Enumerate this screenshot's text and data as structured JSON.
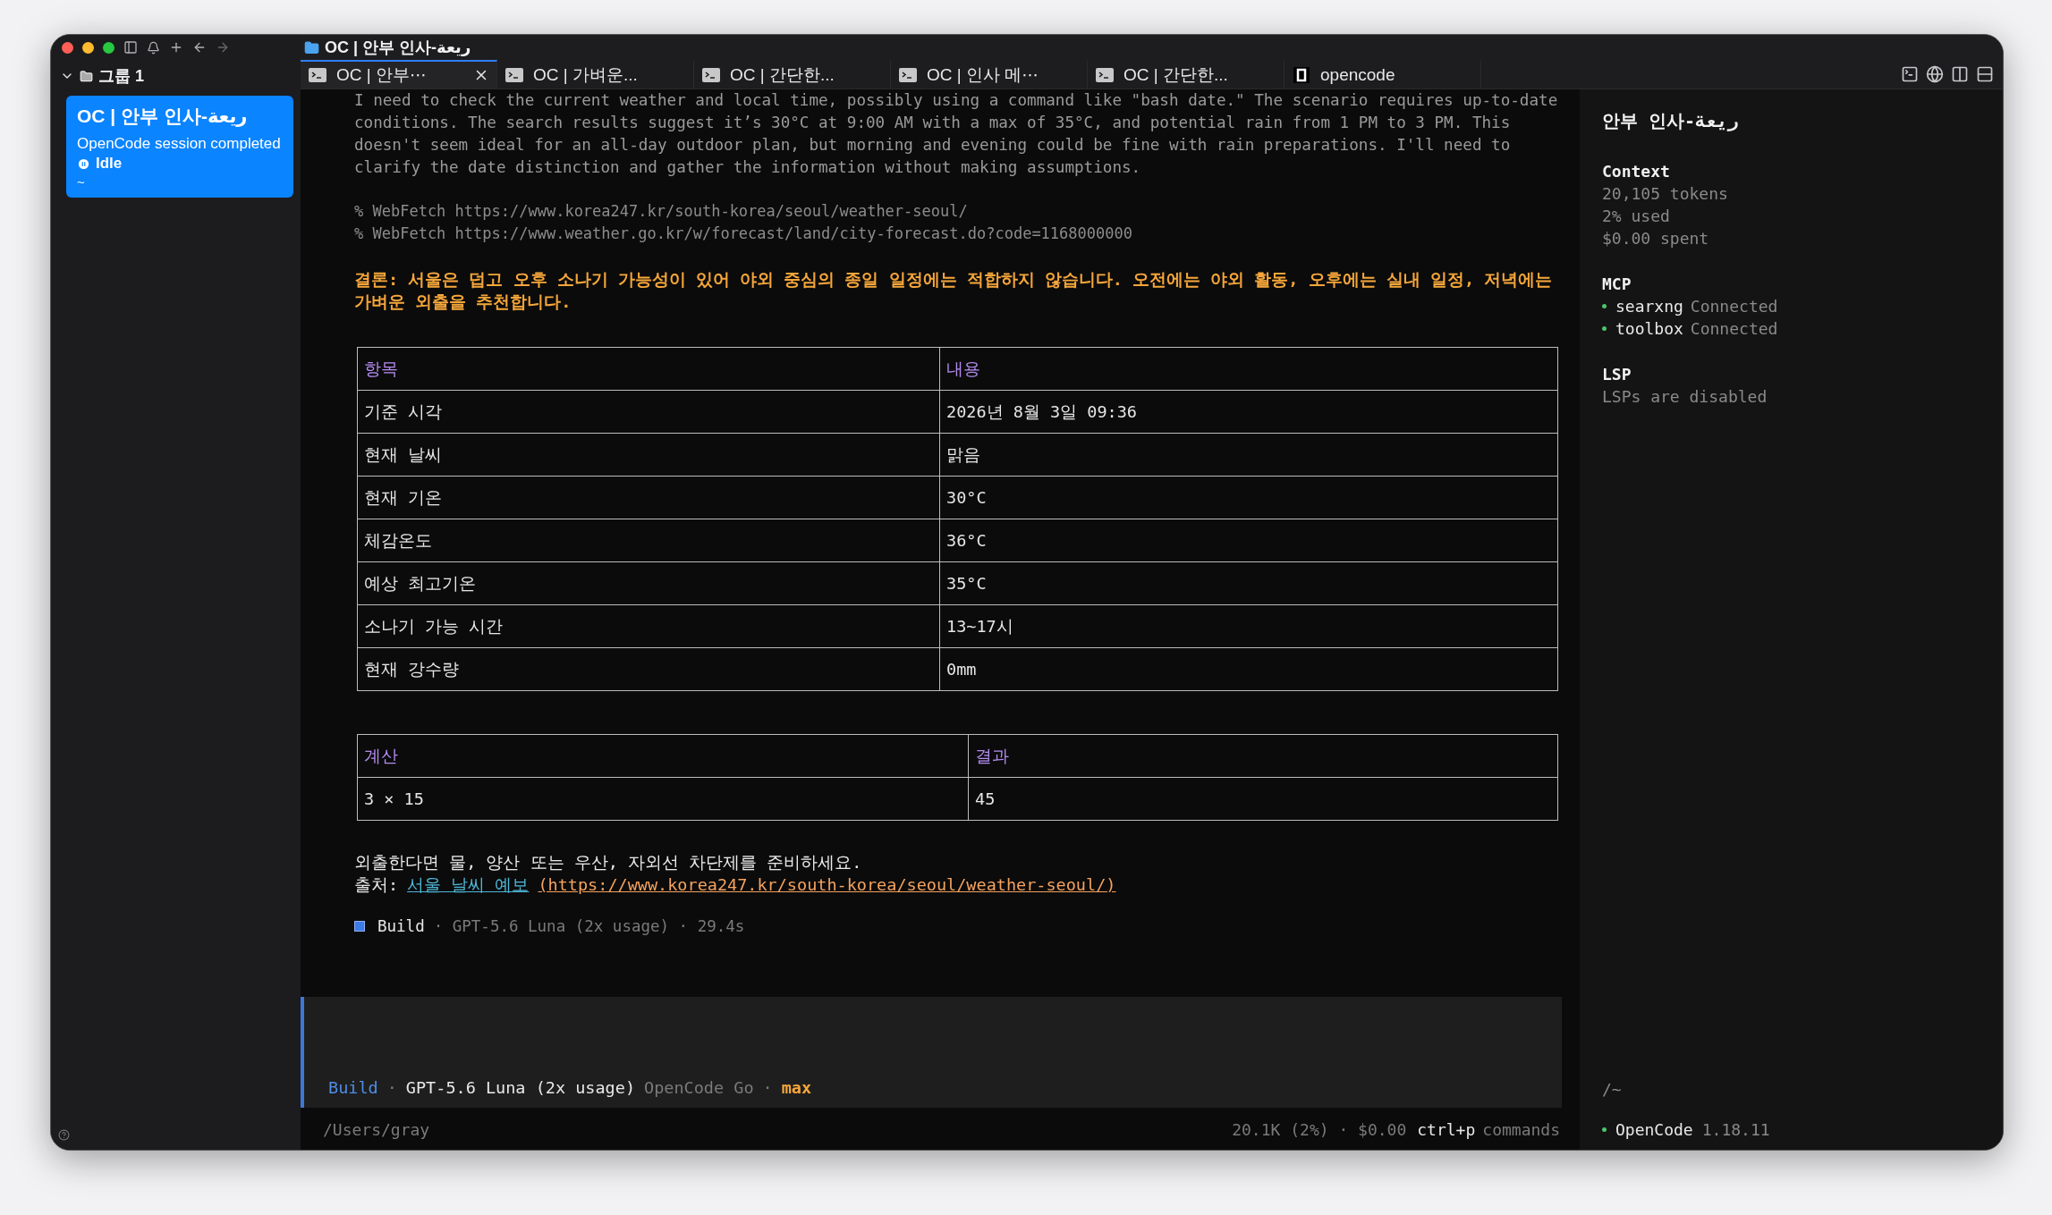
{
  "window": {
    "title": "OC | 안부 인사-ريعة"
  },
  "sidebar": {
    "group": {
      "label": "그룹 1",
      "expanded": true
    },
    "sessions": [
      {
        "title": "OC | 안부 인사-ريعة",
        "subtitle": "OpenCode session completed",
        "status": "Idle",
        "path": "~",
        "selected": true
      }
    ]
  },
  "tabs": [
    {
      "label": "OC | 안부⋯",
      "kind": "terminal",
      "selected": true
    },
    {
      "label": "OC | 가벼운...",
      "kind": "terminal",
      "selected": false
    },
    {
      "label": "OC | 간단한...",
      "kind": "terminal",
      "selected": false
    },
    {
      "label": "OC | 인사 메⋯",
      "kind": "terminal",
      "selected": false
    },
    {
      "label": "OC | 간단한...",
      "kind": "terminal",
      "selected": false
    },
    {
      "label": "opencode",
      "kind": "app",
      "selected": false
    }
  ],
  "transcript": {
    "reasoning": "I need to check the current weather and local time, possibly using a command like \"bash date.\" The scenario requires up-to-date conditions. The search results suggest it’s 30°C at 9:00 AM with a max of 35°C, and potential rain from 1 PM to 3 PM. This doesn't seem ideal for an all-day outdoor plan, but morning and evening could be fine with rain preparations. I'll need to clarify the date distinction and gather the information without making assumptions.",
    "tool_calls": [
      "% WebFetch https://www.korea247.kr/south-korea/seoul/weather-seoul/",
      "% WebFetch https://www.weather.go.kr/w/forecast/land/city-forecast.do?code=1168000000"
    ],
    "conclusion": "결론: 서울은 덥고 오후 소나기 가능성이 있어 야외 중심의 종일 일정에는 적합하지 않습니다. 오전에는 야외 활동, 오후에는 실내 일정, 저녁에는 가벼운 외출을 추천합니다.",
    "tables": [
      {
        "columns": [
          "항목",
          "내용"
        ],
        "rows": [
          [
            "기준 시각",
            "2026년 8월 3일 09:36"
          ],
          [
            "현재 날씨",
            "맑음"
          ],
          [
            "현재 기온",
            "30°C"
          ],
          [
            "체감온도",
            "36°C"
          ],
          [
            "예상 최고기온",
            "35°C"
          ],
          [
            "소나기 가능 시간",
            "13~17시"
          ],
          [
            "현재 강수량",
            "0mm"
          ]
        ]
      },
      {
        "columns": [
          "계산",
          "결과"
        ],
        "rows": [
          [
            "3 × 15",
            "45"
          ]
        ]
      }
    ],
    "note": "외출한다면 물, 양산 또는 우산, 자외선 차단제를 준비하세요.",
    "source": {
      "label": "출처:",
      "link": "서울 날씨 예보",
      "url": "(https://www.korea247.kr/south-korea/seoul/weather-seoul/)"
    },
    "run": {
      "agent": "Build",
      "details": "· GPT-5.6 Luna (2x usage) · 29.4s"
    }
  },
  "prompt": {
    "agent": "Build",
    "separator": "·",
    "model": "GPT-5.6 Luna (2x usage)",
    "provider": "OpenCode Go",
    "variant": "max"
  },
  "status_bar": {
    "path": "/Users/gray",
    "usage": "20.1K (2%) · $0.00",
    "shortcut_key": "ctrl+p",
    "shortcut_label": "commands"
  },
  "side_panel": {
    "title": "안부 인사-ريعة",
    "sections": [
      {
        "heading": "Context",
        "lines": [
          "20,105 tokens",
          "2% used",
          "$0.00 spent"
        ]
      },
      {
        "heading": "MCP",
        "servers": [
          {
            "name": "searxng",
            "status": "Connected"
          },
          {
            "name": "toolbox",
            "status": "Connected"
          }
        ]
      },
      {
        "heading": "LSP",
        "lines": [
          "LSPs are disabled"
        ]
      }
    ],
    "cwd": "/~",
    "app_name": "OpenCode",
    "version": "1.18.11"
  }
}
